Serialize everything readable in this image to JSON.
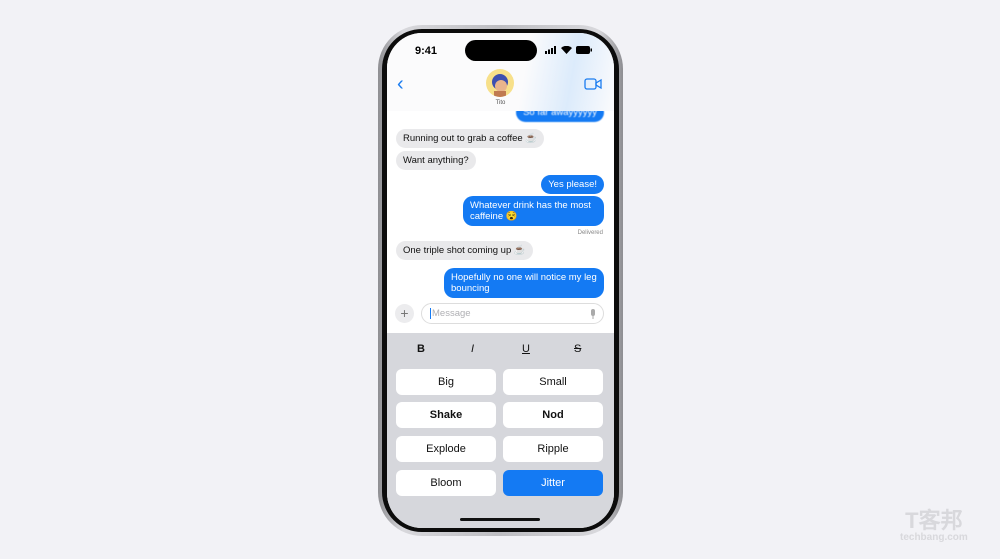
{
  "status": {
    "time": "9:41"
  },
  "header": {
    "contact_name": "Tito"
  },
  "messages": [
    {
      "dir": "out",
      "text": "So far awayyyyyy"
    },
    {
      "dir": "in",
      "text": "Running out to grab a coffee ☕"
    },
    {
      "dir": "in",
      "text": "Want anything?"
    },
    {
      "dir": "out",
      "text": "Yes please!"
    },
    {
      "dir": "out",
      "text": "Whatever drink has the most caffeine 😵"
    },
    {
      "dir": "in",
      "text": "One triple shot coming up ☕"
    },
    {
      "dir": "out",
      "text": "Hopefully no one will notice my leg bouncing"
    }
  ],
  "delivered": "Delivered",
  "input": {
    "placeholder": "Message",
    "plus": "+"
  },
  "format": {
    "bold": "B",
    "italic": "I",
    "underline": "U",
    "strike": "S"
  },
  "effects": [
    {
      "label": "Big",
      "selected": false
    },
    {
      "label": "Small",
      "selected": false
    },
    {
      "label": "Shake",
      "selected": false
    },
    {
      "label": "Nod",
      "selected": false
    },
    {
      "label": "Explode",
      "selected": false
    },
    {
      "label": "Ripple",
      "selected": false
    },
    {
      "label": "Bloom",
      "selected": false
    },
    {
      "label": "Jitter",
      "selected": true
    }
  ],
  "watermark": {
    "logo": "T客邦",
    "site": "techbang.com"
  },
  "colors": {
    "accent": "#147af3",
    "incoming": "#e9e9eb",
    "keyboard": "#d6d7dc"
  }
}
